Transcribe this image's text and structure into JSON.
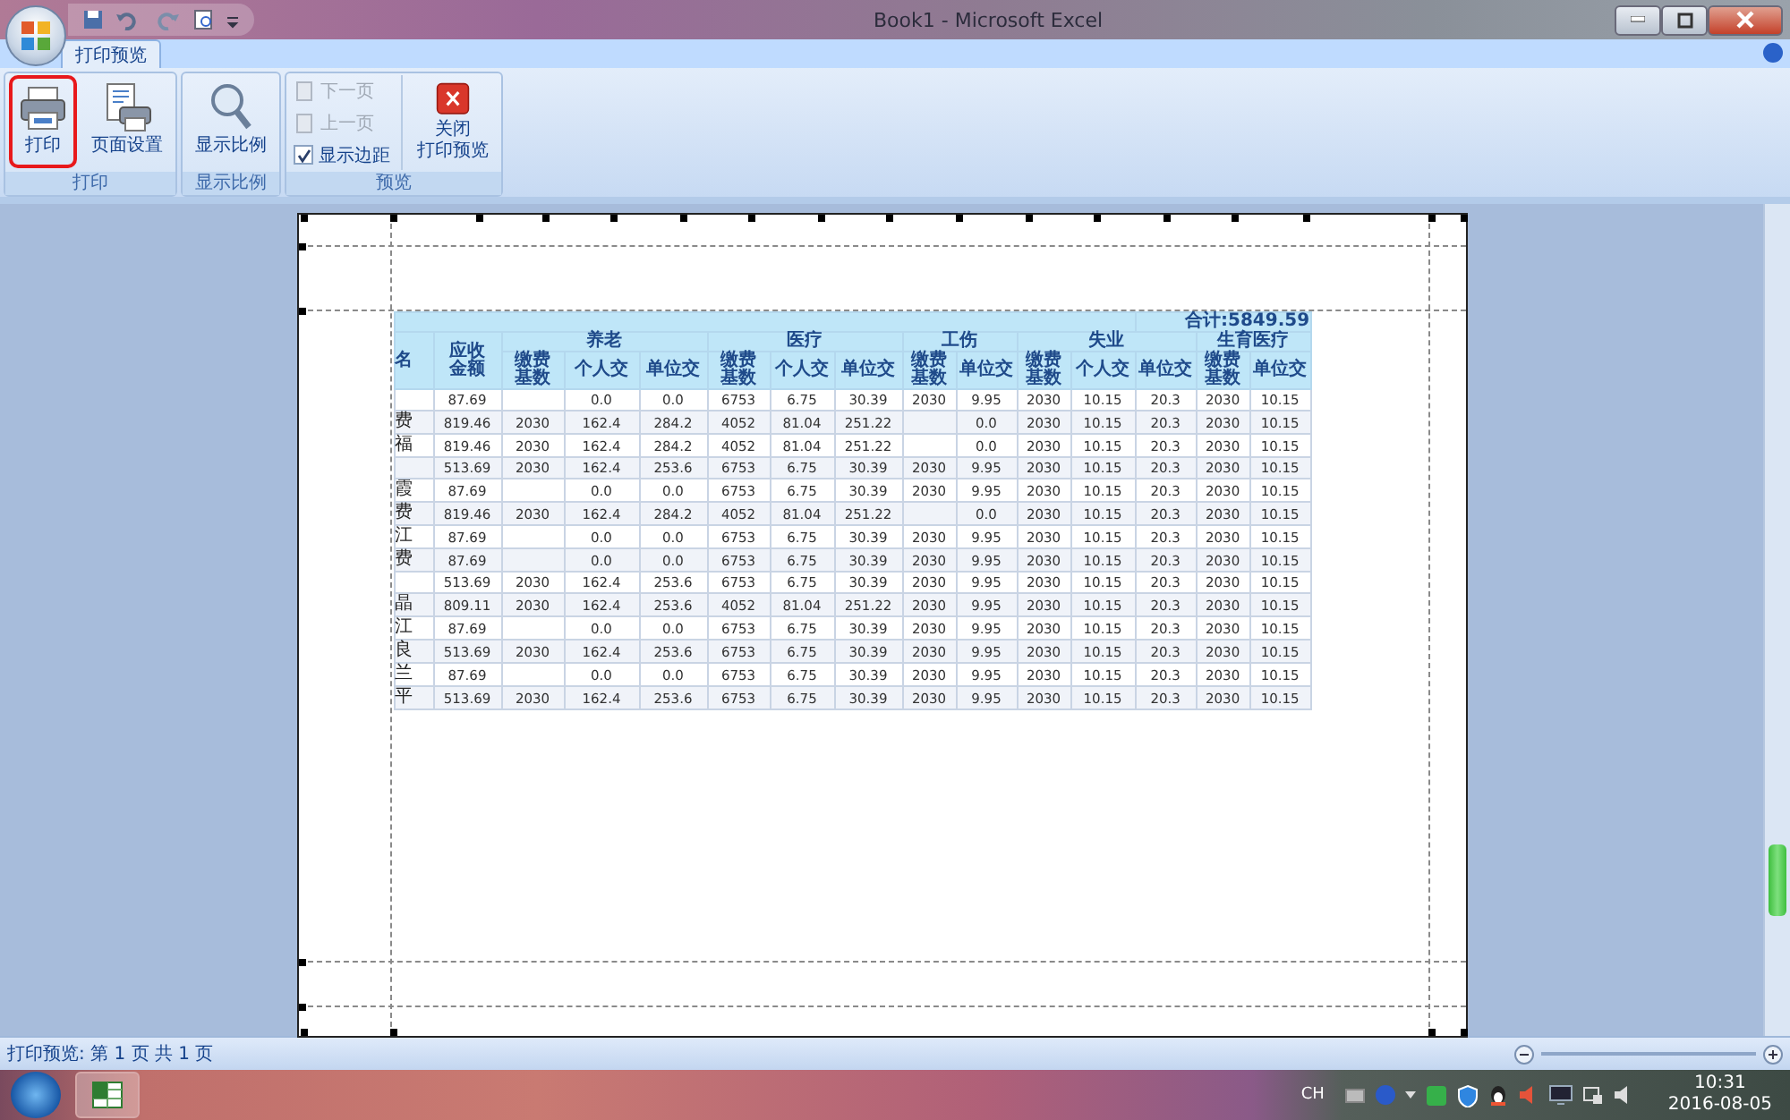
{
  "window": {
    "title": "Book1 - Microsoft Excel"
  },
  "tabs": [
    {
      "label": "打印预览",
      "selected": true
    }
  ],
  "ribbon_groups": [
    {
      "label": "打印",
      "controls": [
        {
          "kind": "print",
          "label": "打印",
          "highlighted": true
        },
        {
          "kind": "setup",
          "label": "页面设置",
          "highlighted": false
        }
      ]
    },
    {
      "label": "显示比例",
      "controls": [
        {
          "kind": "zoom",
          "label": "显示比例",
          "highlighted": false
        }
      ]
    },
    {
      "label": "预览",
      "controls": [
        {
          "kind": "nextpage",
          "label": "下一页",
          "disabled": true
        },
        {
          "kind": "prevpage",
          "label": "上一页",
          "disabled": true
        },
        {
          "kind": "check",
          "label": "显示边距",
          "checked": true
        },
        {
          "kind": "close",
          "lines": [
            "关闭",
            "打印预览"
          ]
        }
      ]
    }
  ],
  "sheet": {
    "total": "合计:5849.59",
    "lead_columns": [
      {
        "lines": [
          "名"
        ]
      },
      {
        "lines": [
          "应收",
          "金额"
        ]
      }
    ],
    "groups": [
      {
        "label": "养老",
        "columns": [
          {
            "lines": [
              "缴费",
              "基数"
            ]
          },
          {
            "lines": [
              "个人交"
            ]
          },
          {
            "lines": [
              "单位交"
            ]
          }
        ]
      },
      {
        "label": "医疗",
        "columns": [
          {
            "lines": [
              "缴费",
              "基数"
            ]
          },
          {
            "lines": [
              "个人交"
            ]
          },
          {
            "lines": [
              "单位交"
            ]
          }
        ]
      },
      {
        "label": "工伤",
        "columns": [
          {
            "lines": [
              "缴费",
              "基数"
            ]
          },
          {
            "lines": [
              "单位交"
            ]
          }
        ]
      },
      {
        "label": "失业",
        "columns": [
          {
            "lines": [
              "缴费",
              "基数"
            ]
          },
          {
            "lines": [
              "个人交"
            ]
          },
          {
            "lines": [
              "单位交"
            ]
          }
        ]
      },
      {
        "label": "生育医疗",
        "columns": [
          {
            "lines": [
              "缴费",
              "基数"
            ]
          },
          {
            "lines": [
              "单位交"
            ]
          }
        ]
      }
    ],
    "rows": [
      [
        null,
        "87.69",
        null,
        "0.0",
        "0.0",
        "6753",
        "6.75",
        "30.39",
        "2030",
        "9.95",
        "2030",
        "10.15",
        "20.3",
        "2030",
        "10.15"
      ],
      [
        "费",
        "819.46",
        "2030",
        "162.4",
        "284.2",
        "4052",
        "81.04",
        "251.22",
        null,
        "0.0",
        "2030",
        "10.15",
        "20.3",
        "2030",
        "10.15"
      ],
      [
        "福",
        "819.46",
        "2030",
        "162.4",
        "284.2",
        "4052",
        "81.04",
        "251.22",
        null,
        "0.0",
        "2030",
        "10.15",
        "20.3",
        "2030",
        "10.15"
      ],
      [
        null,
        "513.69",
        "2030",
        "162.4",
        "253.6",
        "6753",
        "6.75",
        "30.39",
        "2030",
        "9.95",
        "2030",
        "10.15",
        "20.3",
        "2030",
        "10.15"
      ],
      [
        "霞",
        "87.69",
        null,
        "0.0",
        "0.0",
        "6753",
        "6.75",
        "30.39",
        "2030",
        "9.95",
        "2030",
        "10.15",
        "20.3",
        "2030",
        "10.15"
      ],
      [
        "费",
        "819.46",
        "2030",
        "162.4",
        "284.2",
        "4052",
        "81.04",
        "251.22",
        null,
        "0.0",
        "2030",
        "10.15",
        "20.3",
        "2030",
        "10.15"
      ],
      [
        "江",
        "87.69",
        null,
        "0.0",
        "0.0",
        "6753",
        "6.75",
        "30.39",
        "2030",
        "9.95",
        "2030",
        "10.15",
        "20.3",
        "2030",
        "10.15"
      ],
      [
        "费",
        "87.69",
        null,
        "0.0",
        "0.0",
        "6753",
        "6.75",
        "30.39",
        "2030",
        "9.95",
        "2030",
        "10.15",
        "20.3",
        "2030",
        "10.15"
      ],
      [
        null,
        "513.69",
        "2030",
        "162.4",
        "253.6",
        "6753",
        "6.75",
        "30.39",
        "2030",
        "9.95",
        "2030",
        "10.15",
        "20.3",
        "2030",
        "10.15"
      ],
      [
        "晶",
        "809.11",
        "2030",
        "162.4",
        "253.6",
        "4052",
        "81.04",
        "251.22",
        "2030",
        "9.95",
        "2030",
        "10.15",
        "20.3",
        "2030",
        "10.15"
      ],
      [
        "江",
        "87.69",
        null,
        "0.0",
        "0.0",
        "6753",
        "6.75",
        "30.39",
        "2030",
        "9.95",
        "2030",
        "10.15",
        "20.3",
        "2030",
        "10.15"
      ],
      [
        "良",
        "513.69",
        "2030",
        "162.4",
        "253.6",
        "6753",
        "6.75",
        "30.39",
        "2030",
        "9.95",
        "2030",
        "10.15",
        "20.3",
        "2030",
        "10.15"
      ],
      [
        "兰",
        "87.69",
        null,
        "0.0",
        "0.0",
        "6753",
        "6.75",
        "30.39",
        "2030",
        "9.95",
        "2030",
        "10.15",
        "20.3",
        "2030",
        "10.15"
      ],
      [
        "平",
        "513.69",
        "2030",
        "162.4",
        "253.6",
        "6753",
        "6.75",
        "30.39",
        "2030",
        "9.95",
        "2030",
        "10.15",
        "20.3",
        "2030",
        "10.15"
      ]
    ]
  },
  "status_bar": {
    "text": "打印预览: 第 1 页  共 1 页"
  },
  "taskbar": {
    "language": "CH",
    "time": "10:31",
    "date": "2016-08-05"
  }
}
